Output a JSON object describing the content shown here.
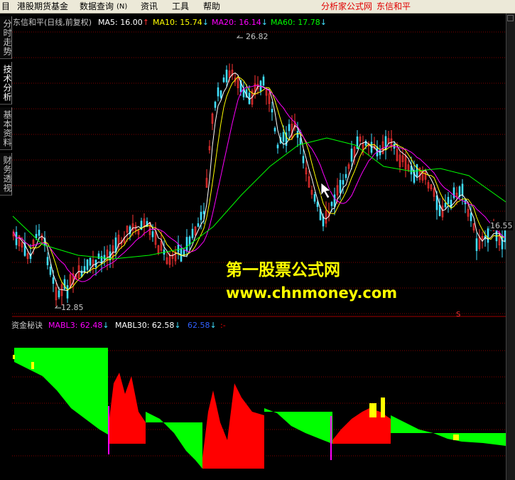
{
  "menu": {
    "items": [
      "港股期货基金",
      "数据查询",
      "资讯",
      "工具",
      "帮助"
    ],
    "shortcut": "(N)",
    "right_links": [
      "分析家公式网",
      "东信和平"
    ]
  },
  "side_tabs": [
    "分时走势",
    "技术分析",
    "基本资料",
    "财务透视"
  ],
  "main_chart": {
    "stock_title": "东信和平(日线,前复权)",
    "ma_legend": [
      {
        "label": "MA5: 16.00",
        "arrow": "↑",
        "color": "#ffffff"
      },
      {
        "label": "MA10: 15.74",
        "arrow": "↓",
        "color": "#ffff00"
      },
      {
        "label": "MA20: 16.14",
        "arrow": "↓",
        "color": "#ff00ff"
      },
      {
        "label": "MA60: 17.78",
        "arrow": "↓",
        "color": "#00ff00"
      }
    ],
    "high_label": "26.82",
    "low_label": "12.85",
    "last_label": "16.55",
    "s_marker": "S"
  },
  "indicator": {
    "title": "资金秘诀",
    "legend": [
      {
        "label": "MABL3: 62.48",
        "arrow": "↓",
        "color": "#ff00ff"
      },
      {
        "label": "MABL30: 62.58",
        "arrow": "↓",
        "color": "#ffffff"
      },
      {
        "label": "62.58",
        "arrow": "↓",
        "color": "#3060ff"
      },
      {
        "label": ":-",
        "arrow": "",
        "color": "#ff0000"
      }
    ]
  },
  "watermark": {
    "line1": "第一股票公式网",
    "line2": "www.chnmoney.com"
  },
  "colors": {
    "up": "#ff3333",
    "down": "#40e0ff",
    "ma5": "#ffffff",
    "ma10": "#ffff00",
    "ma20": "#ff00ff",
    "ma60": "#00ff00",
    "grid": "#800000",
    "ind_red": "#ff0000",
    "ind_green": "#00ff00",
    "ind_yellow": "#ffff00"
  }
}
